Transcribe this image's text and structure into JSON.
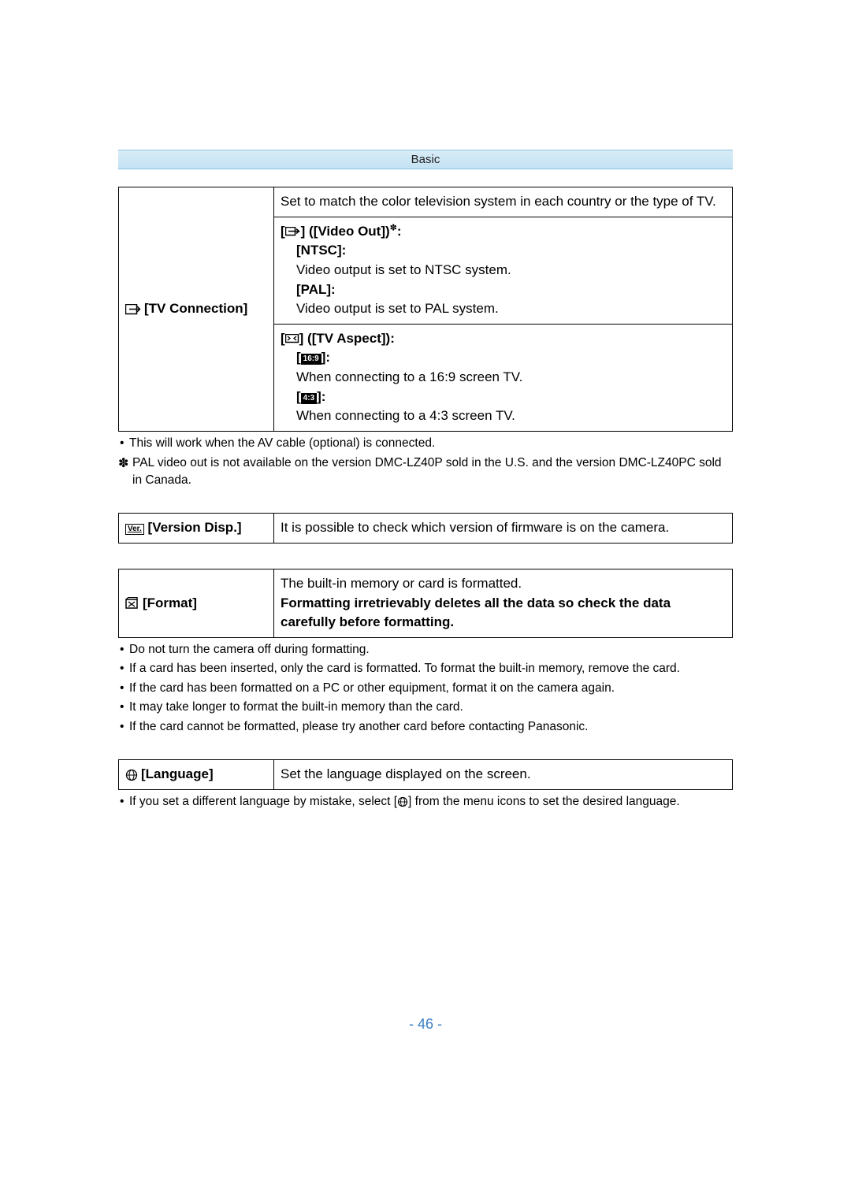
{
  "header": {
    "title": "Basic"
  },
  "tv": {
    "label": "[TV Connection]",
    "r1": "Set to match the color television system in each country or the type of TV.",
    "r2a_prefix": "] ([Video Out])",
    "r2a_suffix": ":",
    "ntsc_label": "[NTSC]:",
    "ntsc_text": "Video output is set to NTSC system.",
    "pal_label": "[PAL]:",
    "pal_text": "Video output is set to PAL system.",
    "r3a": "] ([TV Aspect]):",
    "a169_label": "]:",
    "a169_text": "When connecting to a 16:9 screen TV.",
    "a43_label": "]:",
    "a43_text": "When connecting to a 4:3 screen TV."
  },
  "tv_notes": {
    "n1": "This will work when the AV cable (optional) is connected.",
    "n2": "PAL video out is not available on the version DMC-LZ40P sold in the U.S. and the version DMC-LZ40PC sold in Canada."
  },
  "ver": {
    "iconlabel": "Ver.",
    "label": "[Version Disp.]",
    "text": "It is possible to check which version of firmware is on the camera."
  },
  "format": {
    "label": "[Format]",
    "line1": "The built-in memory or card is formatted.",
    "line2": "Formatting irretrievably deletes all the data so check the data carefully before formatting."
  },
  "format_notes": {
    "n1": "Do not turn the camera off during formatting.",
    "n2": "If a card has been inserted, only the card is formatted. To format the built-in memory, remove the card.",
    "n3": "If the card has been formatted on a PC or other equipment, format it on the camera again.",
    "n4": "It may take longer to format the built-in memory than the card.",
    "n5": "If the card cannot be formatted, please try another card before contacting Panasonic."
  },
  "lang": {
    "label": "[Language]",
    "text": "Set the language displayed on the screen."
  },
  "lang_notes": {
    "n1a": "If you set a different language by mistake, select [",
    "n1b": "] from the menu icons to set the desired language."
  },
  "page_number": "- 46 -"
}
